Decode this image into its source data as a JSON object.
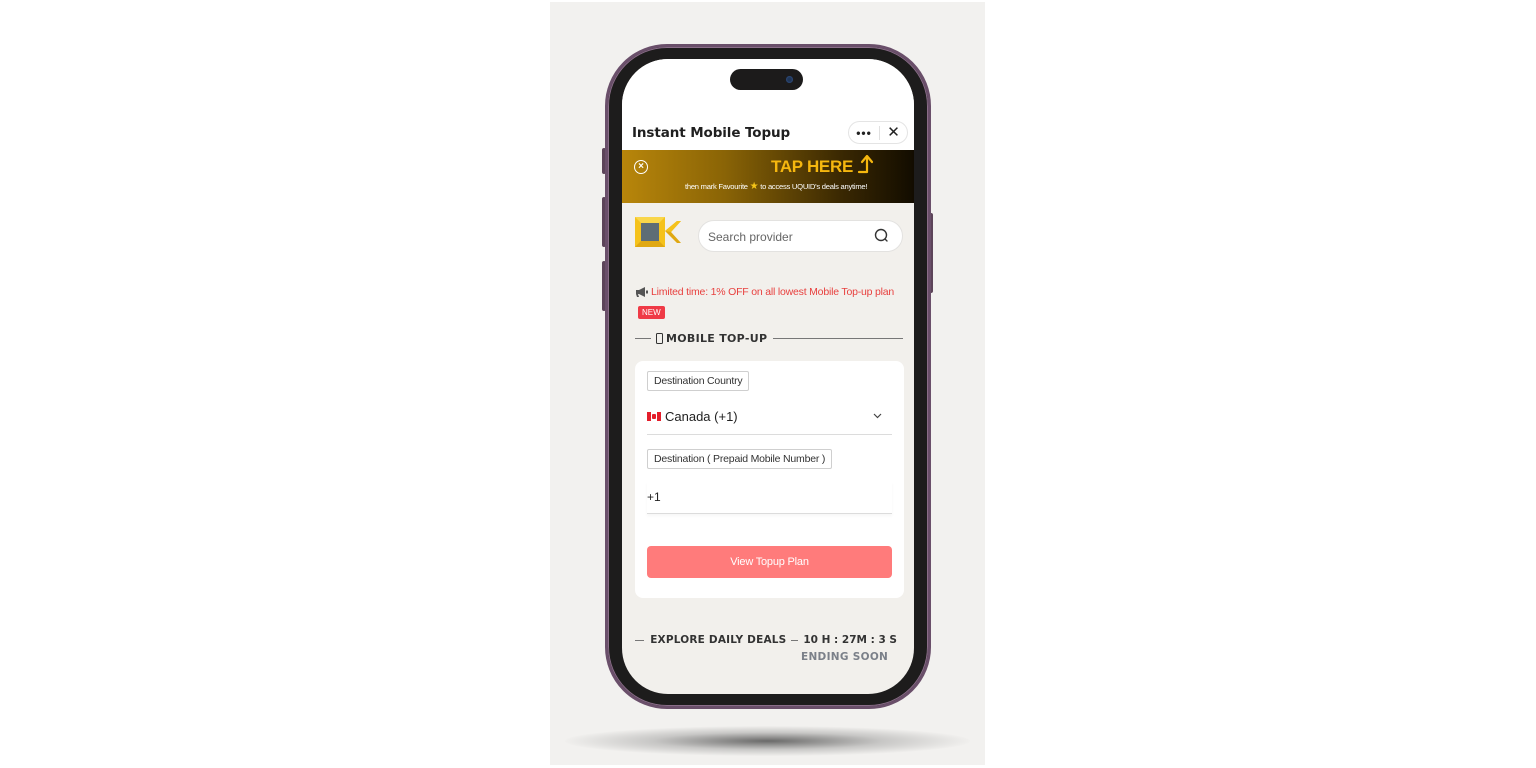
{
  "app": {
    "title": "Instant Mobile Topup",
    "more_menu_label": "•••",
    "close_label": "✕"
  },
  "banner": {
    "dismiss_icon": "close-circle-icon",
    "headline": "TAP HERE",
    "subtext_before": "then mark Favourite",
    "subtext_after": "to access UQUID's deals anytime!",
    "star_glyph": "★",
    "colors": {
      "headline": "#f5b70f",
      "bg_start": "#b8860b",
      "bg_end": "#120c00"
    }
  },
  "search": {
    "placeholder": "Search provider",
    "icon": "search-icon"
  },
  "promo": {
    "icon": "megaphone-icon",
    "text": "Limited time: 1% OFF on all lowest Mobile Top-up plan",
    "badge": "NEW",
    "color": "#e8413f"
  },
  "section": {
    "icon": "mobile-phone-icon",
    "title": "MOBILE TOP-UP"
  },
  "form": {
    "country_label": "Destination Country",
    "country_value": "Canada (+1)",
    "country_flag": "canada-flag",
    "number_label": "Destination ( Prepaid Mobile Number )",
    "number_value": "+1",
    "submit_label": "View Topup Plan",
    "submit_color": "#ff7b7b"
  },
  "deals": {
    "title": "EXPLORE DAILY DEALS",
    "timer": "10 H : 27M :  3 S",
    "status": "ENDING SOON"
  }
}
